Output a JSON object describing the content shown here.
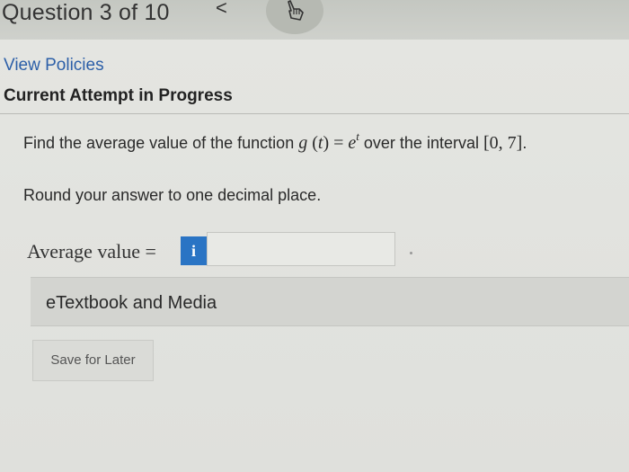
{
  "header": {
    "question_counter": "Question 3 of 10",
    "prev_glyph": "<",
    "nav_icon": "pointer-hand-icon"
  },
  "policies": {
    "link_label": "View Policies"
  },
  "attempt": {
    "heading": "Current Attempt in Progress"
  },
  "question": {
    "prefix": "Find the average value of the function ",
    "func_name": "g",
    "func_open": " (",
    "func_var": "t",
    "func_close": ") = ",
    "base": "e",
    "exponent": "t",
    "middle": " over the interval ",
    "interval": "[0, 7]",
    "suffix": ".",
    "instruction": "Round your answer to one decimal place."
  },
  "answer": {
    "label": "Average value =",
    "info_label": "i",
    "value": ""
  },
  "resources": {
    "etextbook_label": "eTextbook and Media"
  },
  "actions": {
    "save_label": "Save for Later"
  },
  "colors": {
    "link": "#2c5fa8",
    "info_button": "#2a74c4"
  }
}
